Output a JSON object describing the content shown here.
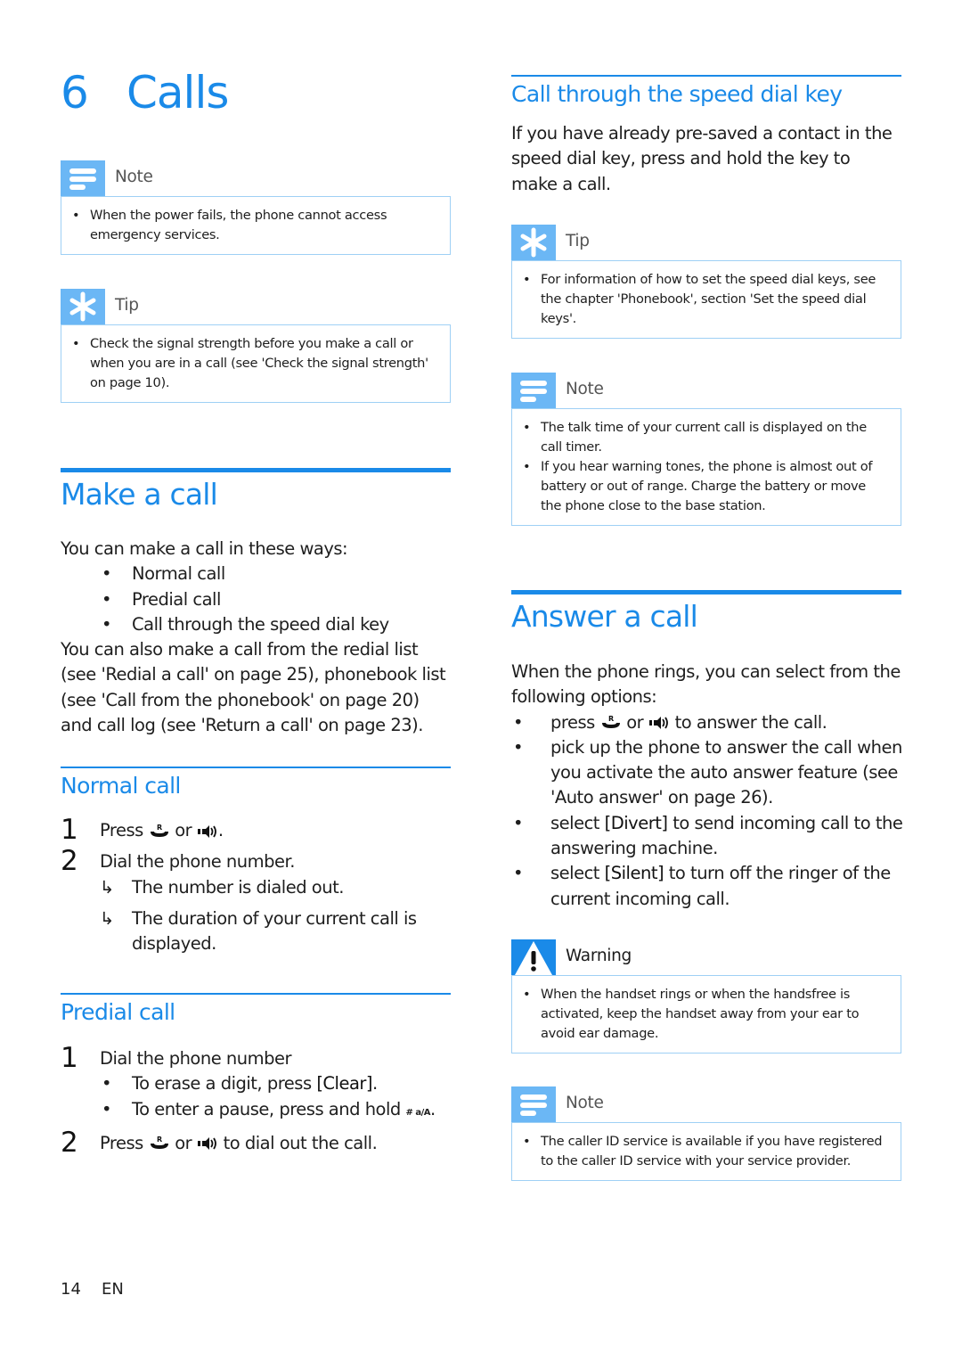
{
  "chapter": {
    "number": "6",
    "title": "Calls"
  },
  "left": {
    "note1": {
      "title": "Note",
      "icon": "note-icon",
      "items": [
        "When the power fails, the phone cannot access emergency services."
      ]
    },
    "tip1": {
      "title": "Tip",
      "icon": "tip-icon",
      "items": [
        "Check the signal strength before you make a call or when you are in a call (see 'Check the signal strength' on page 10)."
      ]
    },
    "make_call": {
      "heading": "Make a call",
      "intro": "You can make a call in these ways:",
      "ways": [
        "Normal call",
        "Predial call",
        "Call through the speed dial key"
      ],
      "also": "You can also make a call from the redial list (see 'Redial a call' on page 25), phonebook list (see 'Call from the phonebook' on page 20) and call log (see 'Return a call' on page 23)."
    },
    "normal_call": {
      "heading": "Normal call",
      "step1": {
        "num": "1",
        "pre": "Press",
        "mid": "or",
        "post": "."
      },
      "step2": {
        "num": "2",
        "text": "Dial the phone number."
      },
      "results": [
        "The number is dialed out.",
        "The duration of your current call is displayed."
      ]
    },
    "predial_call": {
      "heading": "Predial call",
      "step1": {
        "num": "1",
        "text": "Dial the phone number"
      },
      "sub1": {
        "pre": "To erase a digit, press ",
        "key": "[Clear]",
        "post": "."
      },
      "sub2": {
        "pre": "To enter a pause, press and hold",
        "key_icon": "# a/A",
        "post": "."
      },
      "step2": {
        "num": "2",
        "pre": "Press",
        "mid": "or",
        "post": "to dial out the call."
      }
    }
  },
  "right": {
    "speed_dial": {
      "heading": "Call through the speed dial key",
      "text": "If you have already pre-saved a contact in the speed dial key, press and hold the key to make a call."
    },
    "tip2": {
      "title": "Tip",
      "icon": "tip-icon",
      "items": [
        "For information of how to set the speed dial keys, see the chapter 'Phonebook', section 'Set the speed dial keys'."
      ]
    },
    "note2": {
      "title": "Note",
      "icon": "note-icon",
      "items": [
        "The talk time of your current call is displayed on the call timer.",
        "If you hear warning tones, the phone is almost out of battery or out of range. Charge the battery or move the phone close to the base station."
      ]
    },
    "answer_call": {
      "heading": "Answer a call",
      "intro": "When the phone rings, you can select from the following options:",
      "opt1": {
        "pre": "press",
        "mid": "or",
        "post": "to answer the call."
      },
      "opt2": "pick up the phone to answer the call when you activate the auto answer feature (see 'Auto answer' on page 26).",
      "opt3": {
        "pre": "select ",
        "key": "[Divert]",
        "post": " to send incoming call to the answering machine."
      },
      "opt4": {
        "pre": "select ",
        "key": "[Silent]",
        "post": " to turn off the ringer of the current incoming call."
      }
    },
    "warning": {
      "title": "Warning",
      "icon": "warning-icon",
      "items": [
        "When the handset rings or when the handsfree is activated, keep the handset away from your ear to avoid ear damage."
      ]
    },
    "note3": {
      "title": "Note",
      "icon": "note-icon",
      "items": [
        "The caller ID service is available if you have registered to the caller ID service with your service provider."
      ]
    }
  },
  "footer": {
    "page": "14",
    "lang": "EN"
  },
  "colors": {
    "accent": "#1a8ae8",
    "icon_bg": "#6bb7f5",
    "box_border": "#9fd0f5"
  },
  "bullet": "•",
  "arrow": "↳"
}
